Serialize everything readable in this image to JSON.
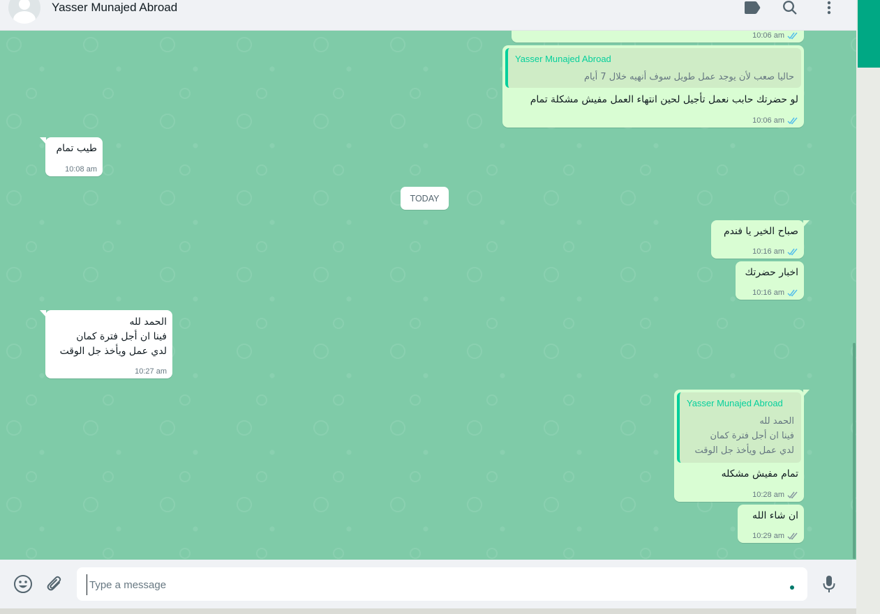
{
  "header": {
    "contact_name": "Yasser Munajed Abroad",
    "icons": [
      "label-icon",
      "search-icon",
      "menu-icon"
    ]
  },
  "date_chip": "TODAY",
  "messages": [
    {
      "id": "m0",
      "direction": "out",
      "time": "10:06 am",
      "status": "read"
    },
    {
      "id": "m1",
      "direction": "out",
      "quote_author": "Yasser Munajed Abroad",
      "quote_text": "حاليا صعب لأن يوجد عمل طويل سوف أنهيه خلال 7 أيام",
      "text": "لو حضرتك حابب نعمل تأجيل لحين انتهاء العمل مفيش مشكلة تمام",
      "time": "10:06 am",
      "status": "read"
    },
    {
      "id": "m2",
      "direction": "in",
      "text": "طيب تمام",
      "time": "10:08 am"
    },
    {
      "id": "m3",
      "direction": "out",
      "text": "صباح الخير يا فندم",
      "time": "10:16 am",
      "status": "read"
    },
    {
      "id": "m4",
      "direction": "out",
      "text": "اخبار حضرتك",
      "time": "10:16 am",
      "status": "read"
    },
    {
      "id": "m5",
      "direction": "in",
      "text": "الحمد لله\nفينا ان أجل فترة كمان\nلدي عمل ويأخذ جل الوقت",
      "time": "10:27 am"
    },
    {
      "id": "m6",
      "direction": "out",
      "quote_author": "Yasser Munajed Abroad",
      "quote_text": "الحمد لله\nفينا ان أجل فترة كمان\nلدي عمل ويأخذ جل الوقت",
      "text": "تمام مفيش مشكله",
      "time": "10:28 am",
      "status": "delivered"
    },
    {
      "id": "m7",
      "direction": "out",
      "text": "ان شاء الله",
      "time": "10:29 am",
      "status": "delivered"
    }
  ],
  "composer": {
    "placeholder": "Type a message"
  },
  "colors": {
    "chat_bg": "#7fcba8",
    "outgoing": "#d9fdd3",
    "incoming": "#ffffff",
    "read_tick": "#53bdeb",
    "delivered_tick": "#8696a0",
    "quote_accent": "#06cf9c",
    "brand": "#00a884"
  }
}
